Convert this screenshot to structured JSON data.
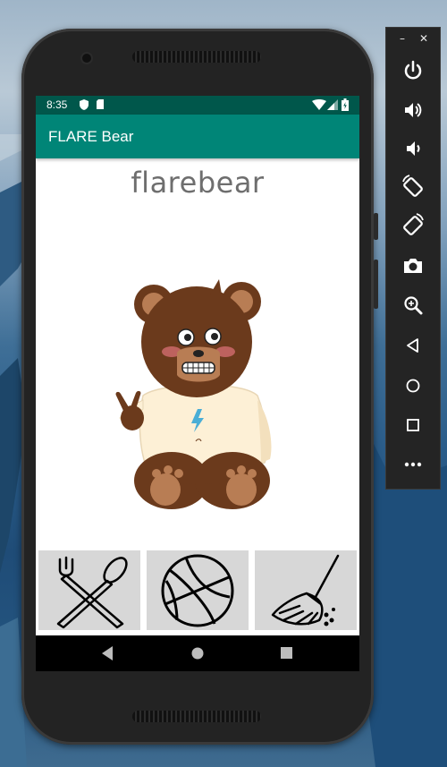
{
  "status_bar": {
    "time": "8:35"
  },
  "app_bar": {
    "title": "FLARE Bear"
  },
  "bear": {
    "name": "flarebear"
  },
  "actions": [
    {
      "name": "feed",
      "icon": "fork-spoon-icon"
    },
    {
      "name": "play",
      "icon": "basketball-icon"
    },
    {
      "name": "clean",
      "icon": "broom-icon"
    }
  ],
  "nav": [
    "back-icon",
    "home-icon",
    "recents-icon"
  ],
  "emulator_toolbar": [
    "power-icon",
    "volume-up-icon",
    "volume-down-icon",
    "rotate-left-icon",
    "rotate-right-icon",
    "camera-icon",
    "zoom-icon",
    "back-icon",
    "home-icon",
    "overview-icon",
    "more-icon"
  ],
  "colors": {
    "status_bar": "#00574b",
    "app_bar": "#008577",
    "bear_brown": "#6b3a1c",
    "shirt": "#fdf0d6",
    "button_bg": "#d7d7d7"
  }
}
